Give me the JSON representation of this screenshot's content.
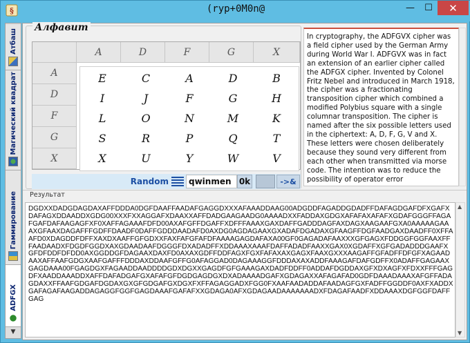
{
  "window": {
    "title": "(ryp+0M0n@",
    "minimize": "—",
    "maximize": "☐",
    "close": "✕"
  },
  "tabs": [
    {
      "label": "Атбаш",
      "icon": "book-icon"
    },
    {
      "label": "Магический квадрат",
      "icon": "globe-icon"
    },
    {
      "label": "Гаммирование",
      "icon": "fish-icon"
    },
    {
      "label": "ADFGX",
      "icon": "bug-icon",
      "active": true
    }
  ],
  "tab_scroll": "▼",
  "alphabet": {
    "legend": "Алфавит",
    "col_headers": [
      "A",
      "D",
      "F",
      "G",
      "X"
    ],
    "row_headers": [
      "A",
      "D",
      "F",
      "G",
      "X"
    ],
    "square": [
      [
        "E",
        "C",
        "A",
        "D",
        "B"
      ],
      [
        "I",
        "J",
        "F",
        "G",
        "H"
      ],
      [
        "L",
        "O",
        "N",
        "M",
        "K"
      ],
      [
        "S",
        "R",
        "P",
        "Q",
        "T"
      ],
      [
        "X",
        "U",
        "Y",
        "W",
        "V"
      ]
    ]
  },
  "controls": {
    "random_label": "Random",
    "key_value": "qwinmen",
    "ok_label": "0k",
    "apply_label": "->&"
  },
  "info_text": "In cryptography, the ADFGVX cipher was a field cipher used by the German Army during World War I. ADFGVX was in fact an extension of an earlier cipher called the ADFGX cipher. Invented by Colonel Fritz Nebel and introduced in March 1918, the cipher was a fractionating transposition cipher which combined a modified Polybius square with a single columnar transposition. The cipher is named after the six possible letters used in the ciphertext: A, D, F, G, V and X. These letters were chosen deliberately because they sound very different from each other when transmitted via morse code. The intention was to reduce the possibility of operator error",
  "result": {
    "label": "Результат",
    "text": "DGDXXDADGDAGDAXAFFDDDA0DGFDAAFFAADAFGAGGDXXXAFAAADDAAG00ADGDDFAGADDGDADFFDAFAGDGAFDFXGAFXDAFAGXDDAADDXGDG00XXXFXXAGGAFXDAAXXAFFDADGAAGAADG0AAAADXXFADDAXGDGXAFAFAXAFAFXGDAFGGGFFAGAFGAFDAFAAGAGFXF0XAFFAGAAAFDFD00AXAFGFFDGAFFXDFFFAAAXGAXDAFFGADDDAGFAXDAGXAAGAAFGXA0AAAAAGAAAXGFAAXDAGAFFFGDFFDAADF0DAFFGDDDAADAFD0AXDG0AGDAGAAXGXADAFDGADAXGFAAGFFDGFAADGAXDAADFF0XFFAAFD0XDAGDDFDFFXAXDXAAFFGFGDXXFAXFAFGFAFDFAAAAGAGDAFAXA00GF0GAGADAFAAXXXGFGAGXFDDGGFGGFAAXFFFAADAADXFDGDFGGDXAXGDAADAAFDGGGFDXADADFFXDDAAAXAAAFDAFFADADFAAXXGAX0XGDAFFXGFGADADDDGAAFXGFDFDDFDFDD0AXGGDDGFDAGAAXDAXFD0AXAXGDFFDDFAGXFGXFAFAXAXGAGXFAAXGXXXAAGAFFGFADFFDFGFXAGAADAAXAFFAAFGDGXAAFGAFFFDDDAXDDAAFGFFG0AFAGGAD0DAGAAAGGFDDDAXAXADDFAAAGAFDAFGDFFX0ADAFFGAGAAXGAGDAAA00FGAGDGXFAGAADDAADDDDGDXDGXXGAGDFGFGAAAGAXDADFDDFF0ADDAFDGDDAXGFXDXAGFXFDXXFFFGAGDFXAADDAAADDXAFFDAFADGAFGXAFAFGFDGDGAGDGXDXADAAAADGAFXGDAGAXXAFAGAFAD0GDFDAAADAAAXAFGFFADAGDAXXFFAAFGDGAFDGDAXGXGFGDGAFGXDGXFXFFAGAGGADXFGG0FXAAFAADADDAFAADAGFGXFADFFGGDDF0AXFXADDXGAFAGAFAAGADDAGAGGFGGFGAGDAAAFGAFAFXXGDAGA0AFXGDAGAADAAAAAAADXFDAGAFAADFXDDAAAXDGFGGFDAFFGAG"
  }
}
